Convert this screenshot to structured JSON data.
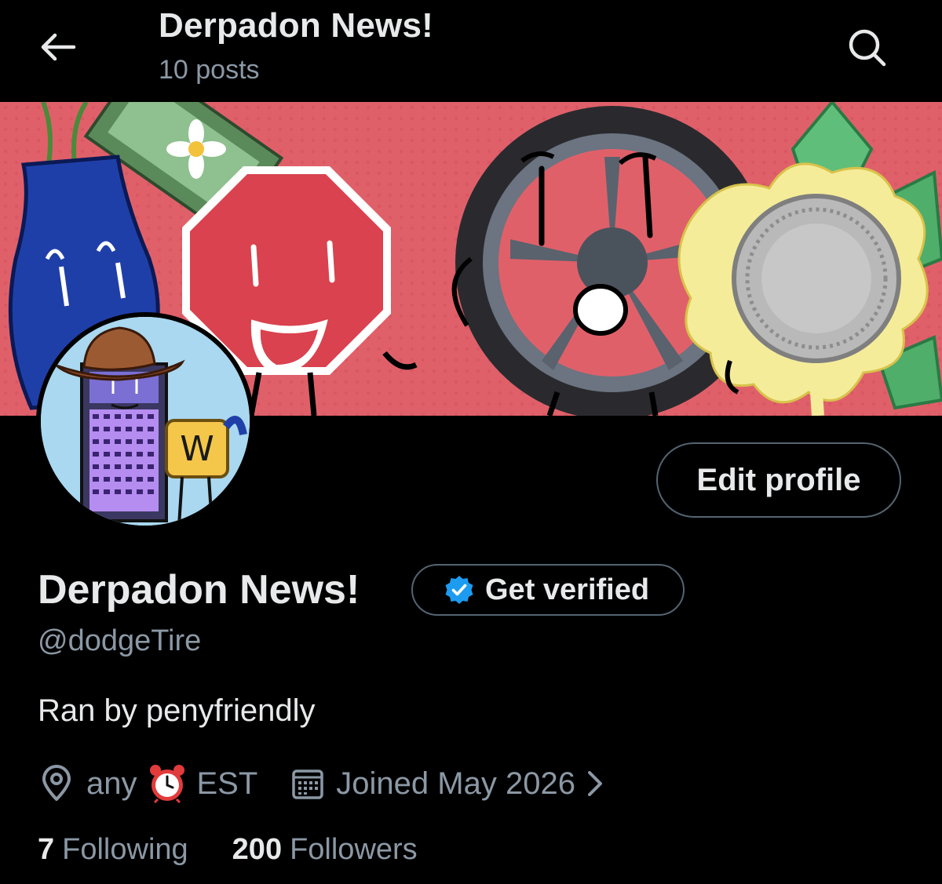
{
  "header": {
    "title": "Derpadon News!",
    "post_count": "10 posts",
    "back_icon": "arrow-left-icon",
    "search_icon": "search-icon"
  },
  "profile": {
    "edit_label": "Edit profile",
    "name": "Derpadon News!",
    "verify_label": "Get verified",
    "handle": "@dodgeTire",
    "bio": "Ran by penyfriendly",
    "location_prefix": "any",
    "location_suffix": "EST",
    "joined": "Joined May 2026",
    "following_count": "7",
    "following_label": "Following",
    "followers_count": "200",
    "followers_label": "Followers",
    "avatar_letter": "W"
  },
  "colors": {
    "background": "#000000",
    "text_primary": "#e7e9ea",
    "text_secondary": "#8b98a5",
    "border": "#536471",
    "verified_blue": "#1d9bf0",
    "banner_red": "#e0606a"
  }
}
